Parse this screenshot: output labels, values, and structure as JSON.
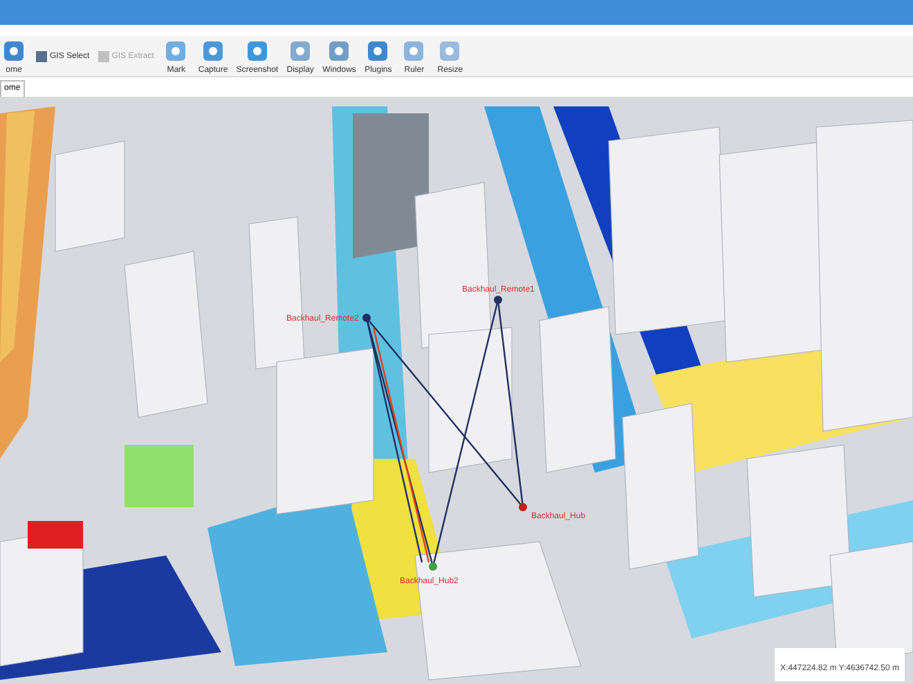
{
  "toolbar": {
    "items": [
      {
        "label": "ome",
        "kind": "large",
        "disabled": false
      },
      {
        "label": "GIS Select",
        "kind": "small",
        "disabled": false
      },
      {
        "label": "GIS Extract",
        "kind": "small",
        "disabled": true
      },
      {
        "label": "Mark",
        "kind": "large",
        "disabled": false
      },
      {
        "label": "Capture",
        "kind": "large",
        "disabled": false
      },
      {
        "label": "Screenshot",
        "kind": "large",
        "disabled": false
      },
      {
        "label": "Display",
        "kind": "large",
        "disabled": false
      },
      {
        "label": "Windows",
        "kind": "large",
        "disabled": false
      },
      {
        "label": "Plugins",
        "kind": "large",
        "disabled": false
      },
      {
        "label": "Ruler",
        "kind": "large",
        "disabled": false
      },
      {
        "label": "Resize",
        "kind": "large",
        "disabled": false
      }
    ]
  },
  "doc_tabs": [
    {
      "label": "ome",
      "selected": true
    }
  ],
  "scene": {
    "sites": [
      {
        "label": "Backhaul_Remote2"
      },
      {
        "label": "Backhaul_Remote1"
      },
      {
        "label": "Backhaul_Hub"
      },
      {
        "label": "Backhaul_Hub2"
      }
    ]
  },
  "status_bar": {
    "coordinates": "X:447224.82 m Y:4636742.50 m"
  }
}
